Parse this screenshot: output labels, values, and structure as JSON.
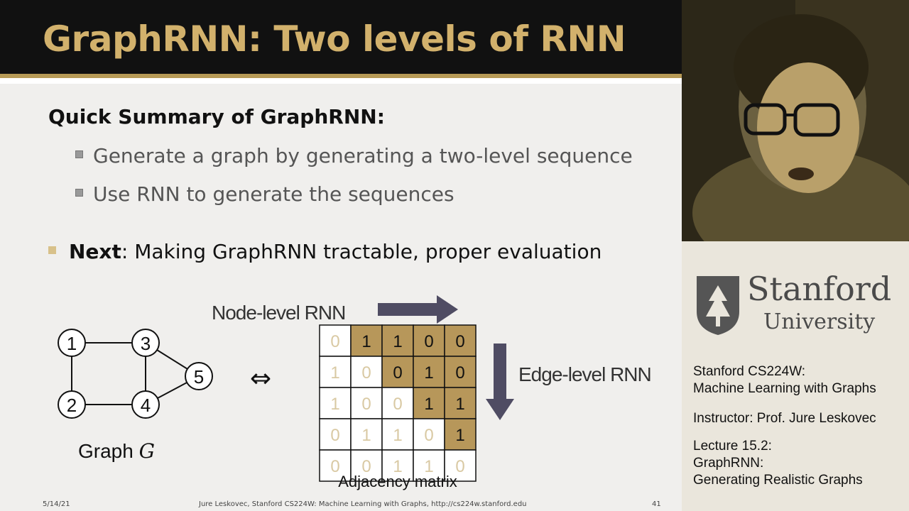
{
  "slide": {
    "title": "GraphRNN: Two levels of RNN",
    "heading": "Quick Summary of GraphRNN:",
    "sub_bullets": [
      "Generate a graph by generating a two-level sequence",
      "Use RNN to generate the sequences"
    ],
    "next_label": "Next",
    "next_text": ": Making GraphRNN tractable, proper evaluation"
  },
  "diagram": {
    "graph_label": "Graph ",
    "graph_var": "G",
    "equiv": "⇔",
    "nodes": [
      "1",
      "2",
      "3",
      "4",
      "5"
    ],
    "node_level_label": "Node-level RNN",
    "edge_level_label": "Edge-level RNN",
    "matrix_label": "Adjacency matrix",
    "matrix": [
      [
        "0",
        "1",
        "1",
        "0",
        "0"
      ],
      [
        "1",
        "0",
        "0",
        "1",
        "0"
      ],
      [
        "1",
        "0",
        "0",
        "1",
        "1"
      ],
      [
        "0",
        "1",
        "1",
        "0",
        "1"
      ],
      [
        "0",
        "0",
        "1",
        "1",
        "0"
      ]
    ],
    "highlight_color": "#b7975a"
  },
  "footer": {
    "date": "5/14/21",
    "credit": "Jure Leskovec, Stanford CS224W: Machine Learning with Graphs, http://cs224w.stanford.edu",
    "page": "41"
  },
  "sidebar": {
    "logo_name": "Stanford",
    "logo_univ": "University",
    "course_line1": "Stanford CS224W:",
    "course_line2": "Machine Learning with Graphs",
    "instructor": "Instructor: Prof. Jure Leskovec",
    "lecture_line1": "Lecture 15.2:",
    "lecture_line2": "GraphRNN:",
    "lecture_line3": "Generating Realistic Graphs"
  }
}
